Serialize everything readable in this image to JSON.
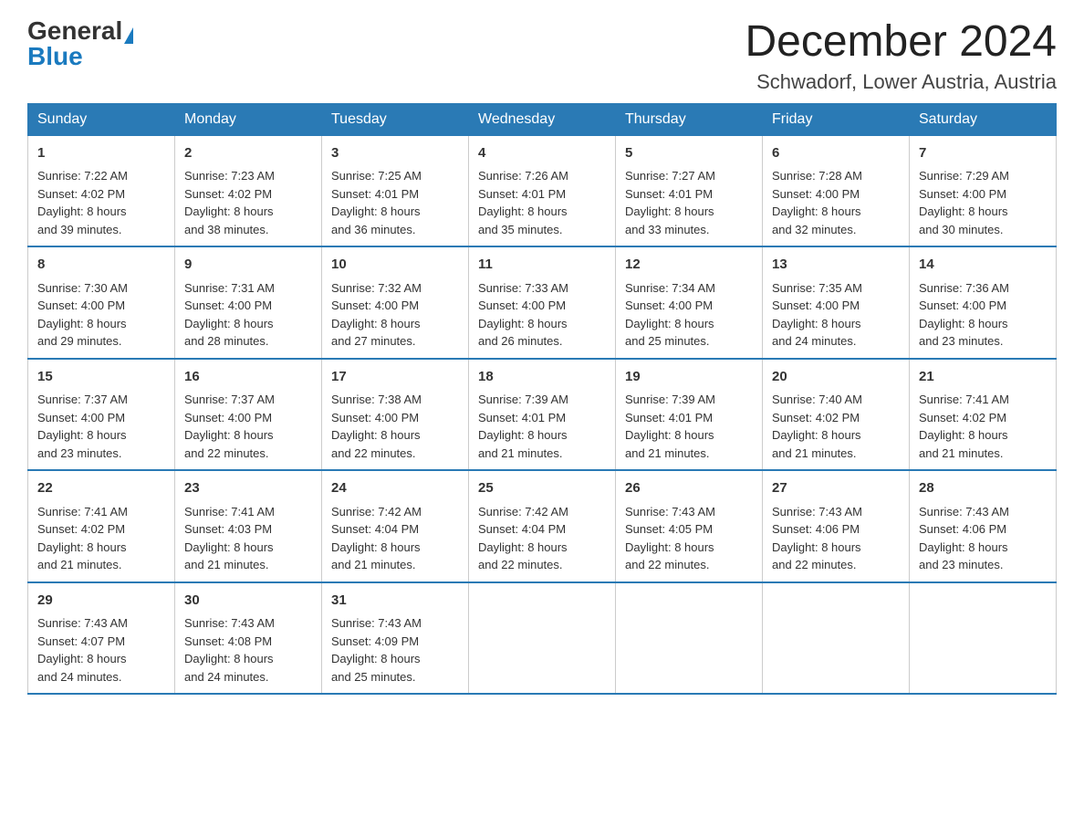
{
  "header": {
    "logo_general": "General",
    "logo_blue": "Blue",
    "month_title": "December 2024",
    "location": "Schwadorf, Lower Austria, Austria"
  },
  "days_of_week": [
    "Sunday",
    "Monday",
    "Tuesday",
    "Wednesday",
    "Thursday",
    "Friday",
    "Saturday"
  ],
  "weeks": [
    [
      {
        "day": "1",
        "sunrise": "7:22 AM",
        "sunset": "4:02 PM",
        "daylight": "8 hours and 39 minutes."
      },
      {
        "day": "2",
        "sunrise": "7:23 AM",
        "sunset": "4:02 PM",
        "daylight": "8 hours and 38 minutes."
      },
      {
        "day": "3",
        "sunrise": "7:25 AM",
        "sunset": "4:01 PM",
        "daylight": "8 hours and 36 minutes."
      },
      {
        "day": "4",
        "sunrise": "7:26 AM",
        "sunset": "4:01 PM",
        "daylight": "8 hours and 35 minutes."
      },
      {
        "day": "5",
        "sunrise": "7:27 AM",
        "sunset": "4:01 PM",
        "daylight": "8 hours and 33 minutes."
      },
      {
        "day": "6",
        "sunrise": "7:28 AM",
        "sunset": "4:00 PM",
        "daylight": "8 hours and 32 minutes."
      },
      {
        "day": "7",
        "sunrise": "7:29 AM",
        "sunset": "4:00 PM",
        "daylight": "8 hours and 30 minutes."
      }
    ],
    [
      {
        "day": "8",
        "sunrise": "7:30 AM",
        "sunset": "4:00 PM",
        "daylight": "8 hours and 29 minutes."
      },
      {
        "day": "9",
        "sunrise": "7:31 AM",
        "sunset": "4:00 PM",
        "daylight": "8 hours and 28 minutes."
      },
      {
        "day": "10",
        "sunrise": "7:32 AM",
        "sunset": "4:00 PM",
        "daylight": "8 hours and 27 minutes."
      },
      {
        "day": "11",
        "sunrise": "7:33 AM",
        "sunset": "4:00 PM",
        "daylight": "8 hours and 26 minutes."
      },
      {
        "day": "12",
        "sunrise": "7:34 AM",
        "sunset": "4:00 PM",
        "daylight": "8 hours and 25 minutes."
      },
      {
        "day": "13",
        "sunrise": "7:35 AM",
        "sunset": "4:00 PM",
        "daylight": "8 hours and 24 minutes."
      },
      {
        "day": "14",
        "sunrise": "7:36 AM",
        "sunset": "4:00 PM",
        "daylight": "8 hours and 23 minutes."
      }
    ],
    [
      {
        "day": "15",
        "sunrise": "7:37 AM",
        "sunset": "4:00 PM",
        "daylight": "8 hours and 23 minutes."
      },
      {
        "day": "16",
        "sunrise": "7:37 AM",
        "sunset": "4:00 PM",
        "daylight": "8 hours and 22 minutes."
      },
      {
        "day": "17",
        "sunrise": "7:38 AM",
        "sunset": "4:00 PM",
        "daylight": "8 hours and 22 minutes."
      },
      {
        "day": "18",
        "sunrise": "7:39 AM",
        "sunset": "4:01 PM",
        "daylight": "8 hours and 21 minutes."
      },
      {
        "day": "19",
        "sunrise": "7:39 AM",
        "sunset": "4:01 PM",
        "daylight": "8 hours and 21 minutes."
      },
      {
        "day": "20",
        "sunrise": "7:40 AM",
        "sunset": "4:02 PM",
        "daylight": "8 hours and 21 minutes."
      },
      {
        "day": "21",
        "sunrise": "7:41 AM",
        "sunset": "4:02 PM",
        "daylight": "8 hours and 21 minutes."
      }
    ],
    [
      {
        "day": "22",
        "sunrise": "7:41 AM",
        "sunset": "4:02 PM",
        "daylight": "8 hours and 21 minutes."
      },
      {
        "day": "23",
        "sunrise": "7:41 AM",
        "sunset": "4:03 PM",
        "daylight": "8 hours and 21 minutes."
      },
      {
        "day": "24",
        "sunrise": "7:42 AM",
        "sunset": "4:04 PM",
        "daylight": "8 hours and 21 minutes."
      },
      {
        "day": "25",
        "sunrise": "7:42 AM",
        "sunset": "4:04 PM",
        "daylight": "8 hours and 22 minutes."
      },
      {
        "day": "26",
        "sunrise": "7:43 AM",
        "sunset": "4:05 PM",
        "daylight": "8 hours and 22 minutes."
      },
      {
        "day": "27",
        "sunrise": "7:43 AM",
        "sunset": "4:06 PM",
        "daylight": "8 hours and 22 minutes."
      },
      {
        "day": "28",
        "sunrise": "7:43 AM",
        "sunset": "4:06 PM",
        "daylight": "8 hours and 23 minutes."
      }
    ],
    [
      {
        "day": "29",
        "sunrise": "7:43 AM",
        "sunset": "4:07 PM",
        "daylight": "8 hours and 24 minutes."
      },
      {
        "day": "30",
        "sunrise": "7:43 AM",
        "sunset": "4:08 PM",
        "daylight": "8 hours and 24 minutes."
      },
      {
        "day": "31",
        "sunrise": "7:43 AM",
        "sunset": "4:09 PM",
        "daylight": "8 hours and 25 minutes."
      },
      null,
      null,
      null,
      null
    ]
  ],
  "labels": {
    "sunrise": "Sunrise: ",
    "sunset": "Sunset: ",
    "daylight": "Daylight: "
  }
}
